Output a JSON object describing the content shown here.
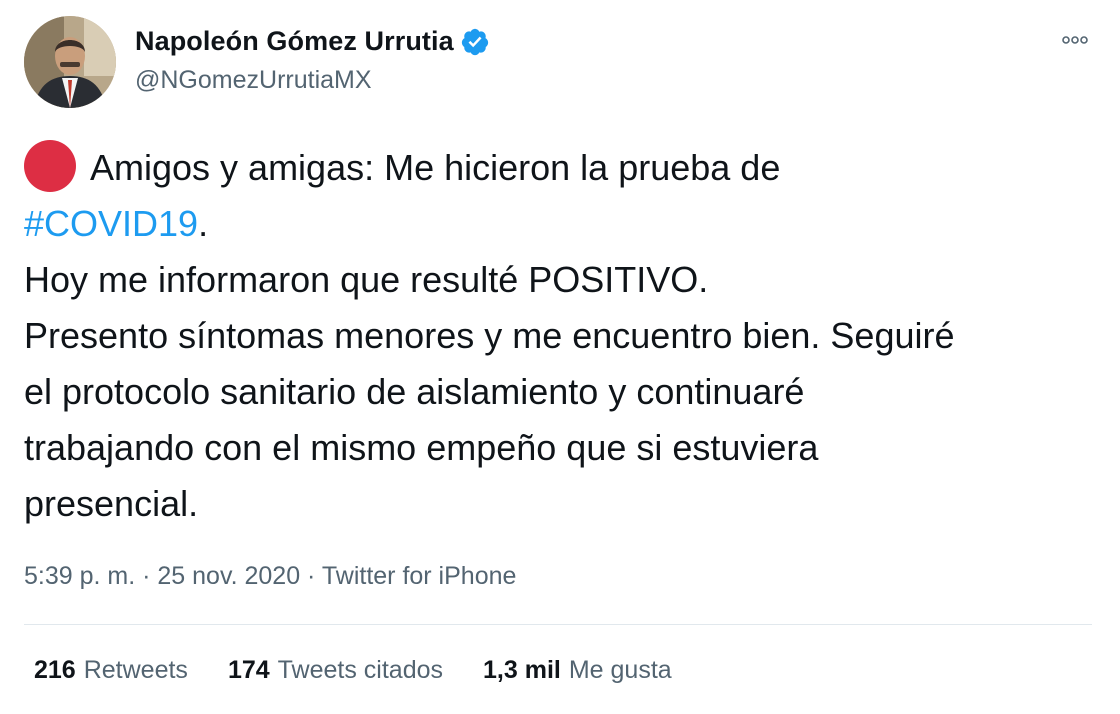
{
  "author": {
    "name": "Napoleón Gómez Urrutia",
    "handle": "@NGomezUrrutiaMX",
    "verified": true,
    "verified_color": "#1d9bf0"
  },
  "tweet": {
    "line1": "Amigos y amigas: Me hicieron la prueba de",
    "hashtag": "#COVID19",
    "hashtag_suffix": ".",
    "line3": "Hoy me informaron que resulté POSITIVO.",
    "line4": "Presento síntomas menores y me encuentro bien. Seguiré",
    "line5": "el protocolo sanitario de aislamiento y continuaré",
    "line6": "trabajando con el mismo empeño que si estuviera",
    "line7": "presencial.",
    "emoji": "red-circle",
    "emoji_color": "#dd2e44"
  },
  "meta": {
    "time": "5:39 p. m.",
    "sep1": " · ",
    "date": "25 nov. 2020",
    "sep2": " · ",
    "source": "Twitter for iPhone"
  },
  "stats": [
    {
      "value": "216",
      "label": "Retweets"
    },
    {
      "value": "174",
      "label": "Tweets citados"
    },
    {
      "value": "1,3 mil",
      "label": "Me gusta"
    }
  ]
}
